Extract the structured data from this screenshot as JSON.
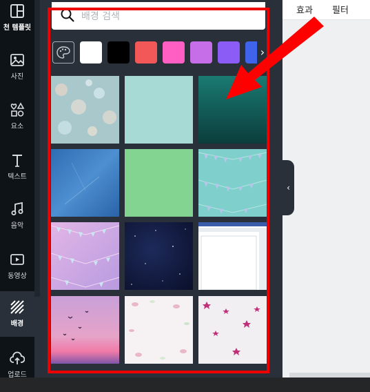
{
  "sidebar": {
    "items": [
      {
        "label": "천 템플릿",
        "icon": "layout-icon"
      },
      {
        "label": "사진",
        "icon": "image-icon"
      },
      {
        "label": "요소",
        "icon": "shapes-icon"
      },
      {
        "label": "텍스트",
        "icon": "text-icon"
      },
      {
        "label": "음악",
        "icon": "music-icon"
      },
      {
        "label": "동영상",
        "icon": "video-icon"
      },
      {
        "label": "배경",
        "icon": "background-hatch-icon",
        "active": true
      },
      {
        "label": "업로드",
        "icon": "upload-icon"
      }
    ]
  },
  "search": {
    "placeholder": "배경 검색"
  },
  "colors": {
    "swatches": [
      "palette",
      "#ffffff",
      "#000000",
      "#f35858",
      "#ff5fc3",
      "#c66de8",
      "#8b5cf6",
      "#3f63ea"
    ],
    "highlight": "#ee0000",
    "panel_bg": "#293039"
  },
  "toolbar": {
    "effects_label": "효과",
    "filter_label": "필터"
  },
  "backgrounds": [
    {
      "name": "bokeh-teal"
    },
    {
      "name": "solid-mint"
    },
    {
      "name": "teal-gradient"
    },
    {
      "name": "blue-sky-texture"
    },
    {
      "name": "solid-green"
    },
    {
      "name": "bunting-teal"
    },
    {
      "name": "bunting-pink"
    },
    {
      "name": "night-stars"
    },
    {
      "name": "document-window"
    },
    {
      "name": "sunset-birds"
    },
    {
      "name": "petals-white"
    },
    {
      "name": "confetti-stars"
    }
  ]
}
